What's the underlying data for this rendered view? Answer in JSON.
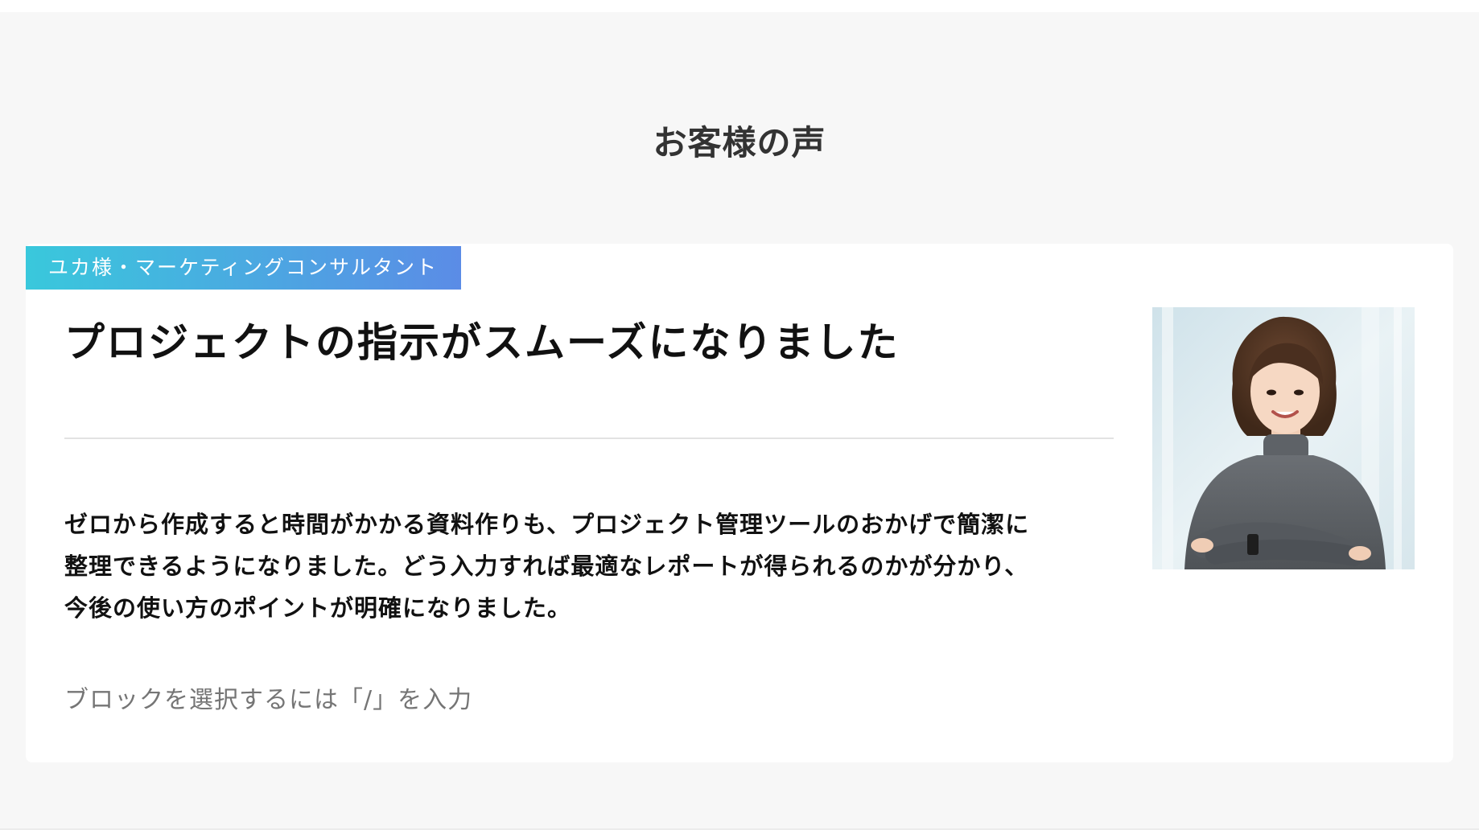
{
  "section": {
    "title": "お客様の声"
  },
  "testimonial": {
    "tag": "ユカ様・マーケティングコンサルタント",
    "headline": "プロジェクトの指示がスムーズになりました",
    "body_lines": [
      "ゼロから作成すると時間がかかる資料作りも、プロジェクト管理ツールのおかげで簡潔に",
      "整理できるようになりました。どう入力すれば最適なレポートが得られるのかが分かり、",
      "今後の使い方のポイントが明確になりました。"
    ],
    "photo_icon": "portrait-photo"
  },
  "editor": {
    "placeholder": "ブロックを選択するには「/」を入力"
  },
  "colors": {
    "tag_gradient_start": "#39c8dc",
    "tag_gradient_end": "#5b8ce6",
    "section_background": "#f7f7f7",
    "card_background": "#ffffff"
  }
}
